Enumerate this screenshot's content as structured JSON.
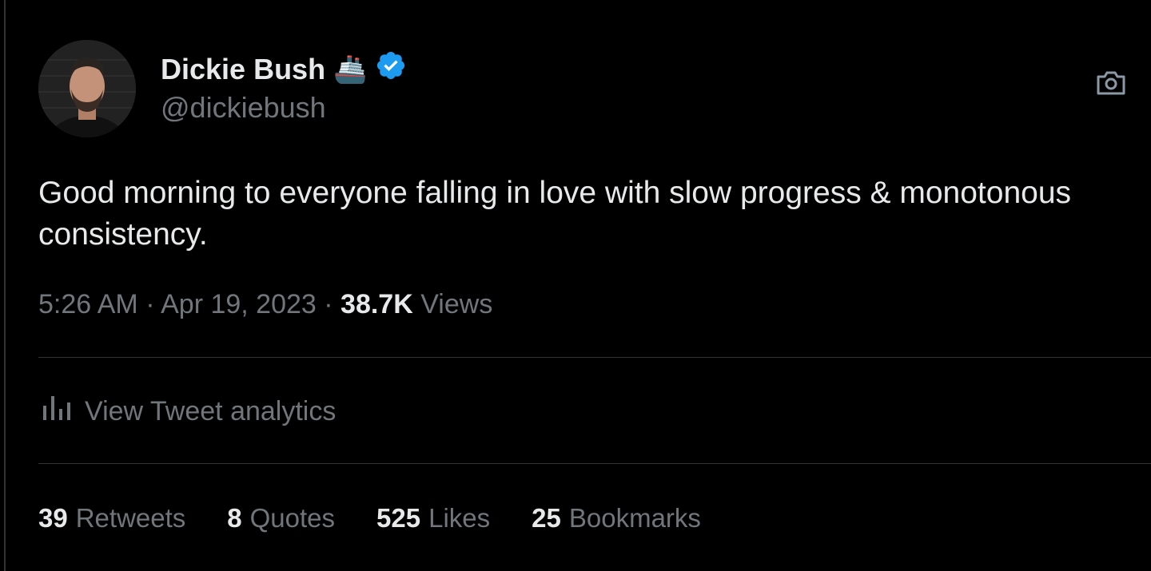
{
  "author": {
    "name": "Dickie Bush",
    "name_emoji": "🚢",
    "verified_icon": "verified-badge-icon",
    "handle": "@dickiebush"
  },
  "tweet": {
    "text": "Good morning to everyone falling in love with slow progress & monotonous consistency.",
    "time": "5:26 AM",
    "date": "Apr 19, 2023",
    "views_count": "38.7K",
    "views_label": "Views",
    "separator": "·"
  },
  "analytics": {
    "icon": "bar-chart-icon",
    "label": "View Tweet analytics"
  },
  "stats": [
    {
      "count": "39",
      "label": "Retweets"
    },
    {
      "count": "8",
      "label": "Quotes"
    },
    {
      "count": "525",
      "label": "Likes"
    },
    {
      "count": "25",
      "label": "Bookmarks"
    }
  ],
  "colors": {
    "background": "#000000",
    "text": "#e7e9ea",
    "secondary": "#71767b",
    "verified": "#1d9bf0",
    "divider": "#2f3336"
  }
}
